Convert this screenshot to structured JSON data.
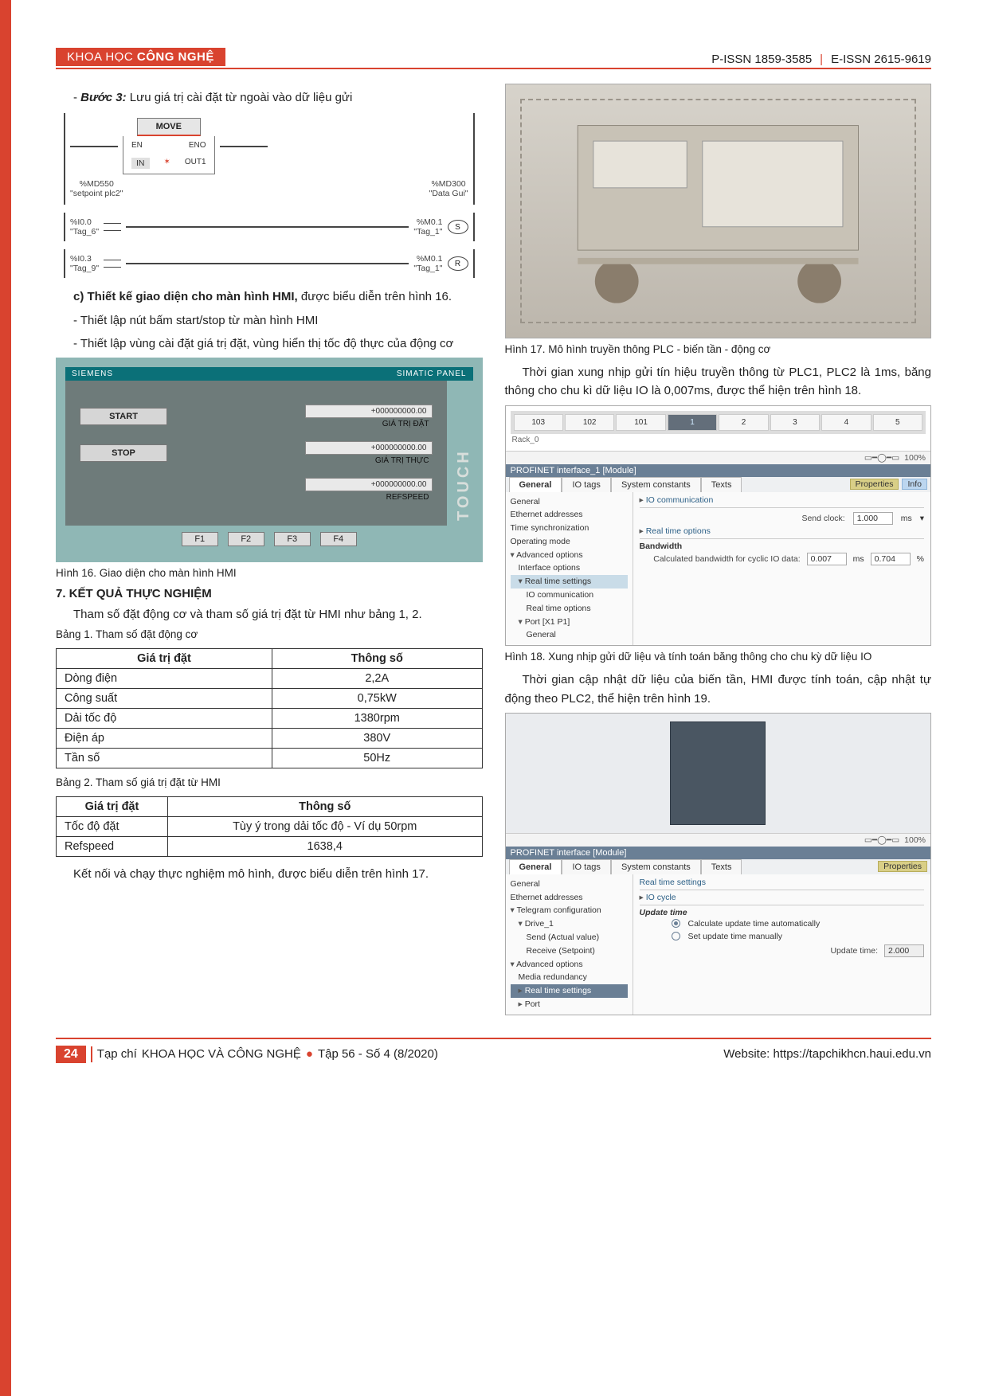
{
  "header": {
    "tag_light": "KHOA HỌC",
    "tag_bold": "CÔNG NGHỆ",
    "pissn": "P-ISSN 1859-3585",
    "eissn": "E-ISSN 2615-9619"
  },
  "left": {
    "step3_prefix": "- ",
    "step3_label": "Bước 3:",
    "step3_text": " Lưu giá trị cài đặt từ ngoài vào dữ liệu gửi",
    "ladder": {
      "move": "MOVE",
      "en": "EN",
      "eno": "ENO",
      "md550": "%MD550",
      "md300": "%MD300",
      "setpoint": "\"setpoint plc2\"",
      "dgui": "\"Data Gui\"",
      "in": "IN",
      "out1": "OUT1",
      "i00": "%I0.0",
      "tag6": "\"Tag_6\"",
      "m01": "%M0.1",
      "tag1": "\"Tag_1\"",
      "i03": "%I0.3",
      "tag9": "\"Tag_9\"",
      "s": "S",
      "r": "R"
    },
    "c_heading": "c) Thiết kế giao diện cho màn hình HMI,",
    "c_tail": " được biểu diễn trên hình 16.",
    "bullet1": "- Thiết lập nút bấm start/stop từ màn hình HMI",
    "bullet2": "- Thiết lập vùng cài đặt giá trị đặt, vùng hiển thị tốc độ thực của động cơ",
    "hmi": {
      "brand": "SIEMENS",
      "panel": "SIMATIC  PANEL",
      "touch": "TOUCH",
      "start": "START",
      "stop": "STOP",
      "numfmt": "+000000000.00",
      "lbl_giatri_dat": "GIÁ TRỊ ĐẶT",
      "lbl_giatri_thuc": "GIÁ TRỊ THỰC",
      "lbl_refspeed": "REFSPEED",
      "f1": "F1",
      "f2": "F2",
      "f3": "F3",
      "f4": "F4"
    },
    "cap16": "Hình 16. Giao diện cho màn hình HMI",
    "sec7": "7. KẾT QUẢ THỰC NGHIỆM",
    "sec7_intro": "Tham số đặt động cơ và tham số giá trị đặt từ HMI như bảng 1, 2.",
    "table1_cap": "Bảng 1. Tham số đặt động cơ",
    "table1": {
      "head": [
        "Giá trị đặt",
        "Thông số"
      ],
      "rows": [
        [
          "Dòng điện",
          "2,2A"
        ],
        [
          "Công suất",
          "0,75kW"
        ],
        [
          "Dải tốc độ",
          "1380rpm"
        ],
        [
          "Điện áp",
          "380V"
        ],
        [
          "Tần số",
          "50Hz"
        ]
      ]
    },
    "table2_cap": "Bảng 2. Tham số giá trị đặt từ HMI",
    "table2": {
      "head": [
        "Giá trị đặt",
        "Thông số"
      ],
      "rows": [
        [
          "Tốc độ đặt",
          "Tùy ý trong dải tốc độ - Ví dụ 50rpm"
        ],
        [
          "Refspeed",
          "1638,4"
        ]
      ]
    },
    "closing": "Kết nối và chạy thực nghiệm mô hình, được biểu diễn trên hình 17."
  },
  "right": {
    "cap17": "Hình 17. Mô hình truyền thông PLC - biến tần - động cơ",
    "p_after17": "Thời gian xung nhịp gửi tín hiệu truyền thông từ PLC1, PLC2 là 1ms, băng thông cho chu kì dữ liệu IO là 0,007ms, được thể hiện trên hình 18.",
    "rack": {
      "cells": [
        "103",
        "102",
        "101",
        "1",
        "2",
        "3",
        "4",
        "5"
      ],
      "rack0": "Rack_0"
    },
    "props_title": "PROFINET interface_1 [Module]",
    "props_tabs": [
      "General",
      "IO tags",
      "System constants",
      "Texts"
    ],
    "props_tree": [
      "General",
      "Ethernet addresses",
      "Time synchronization",
      "Operating mode",
      "Advanced options",
      "Interface options",
      "Real time settings",
      "IO communication",
      "Real time options",
      "Port [X1 P1]",
      "General"
    ],
    "io_comm_title": "IO communication",
    "send_clock_lbl": "Send clock:",
    "send_clock_val": "1.000",
    "send_clock_unit": "ms",
    "rt_opts": "Real time options",
    "bandwidth": "Bandwidth",
    "bw_lbl": "Calculated bandwidth for cyclic IO data:",
    "bw_val": "0.007",
    "bw_unit": "ms",
    "bw_val2": "0.704",
    "bw_unit2": "%",
    "zoom": "100%",
    "chip_prop": "Properties",
    "chip_info": "Info",
    "cap18": "Hình 18. Xung nhịp gửi dữ liệu và tính toán băng thông cho chu kỳ dữ liệu IO",
    "p_after18": "Thời gian cập nhật dữ liệu của biến tần, HMI được tính toán, cập nhật tự động theo PLC2, thể hiện trên hình 19.",
    "props2_title": "PROFINET interface [Module]",
    "props2_tree": [
      "General",
      "Ethernet addresses",
      "Telegram configuration",
      "Drive_1",
      "Send (Actual value)",
      "Receive (Setpoint)",
      "Advanced options",
      "Media redundancy",
      "Real time settings",
      "Port"
    ],
    "rt_title": "Real time settings",
    "io_cycle": "IO cycle",
    "update_time": "Update time",
    "opt_auto": "Calculate update time automatically",
    "opt_manual": "Set update time manually",
    "upd_lbl": "Update time:",
    "upd_val": "2.000"
  },
  "footer": {
    "page": "24",
    "journal": "Tạp chí",
    "journal_caps": "KHOA HỌC VÀ CÔNG NGHỆ",
    "issue": "Tập 56 - Số 4 (8/2020)",
    "site_lbl": "Website:",
    "site": "https://tapchikhcn.haui.edu.vn"
  },
  "chart_data": [
    {
      "type": "table",
      "title": "Bảng 1. Tham số đặt động cơ",
      "columns": [
        "Giá trị đặt",
        "Thông số"
      ],
      "rows": [
        [
          "Dòng điện",
          "2,2A"
        ],
        [
          "Công suất",
          "0,75kW"
        ],
        [
          "Dải tốc độ",
          "1380rpm"
        ],
        [
          "Điện áp",
          "380V"
        ],
        [
          "Tần số",
          "50Hz"
        ]
      ]
    },
    {
      "type": "table",
      "title": "Bảng 2. Tham số giá trị đặt từ HMI",
      "columns": [
        "Giá trị đặt",
        "Thông số"
      ],
      "rows": [
        [
          "Tốc độ đặt",
          "Tùy ý trong dải tốc độ - Ví dụ 50rpm"
        ],
        [
          "Refspeed",
          "1638,4"
        ]
      ]
    }
  ]
}
